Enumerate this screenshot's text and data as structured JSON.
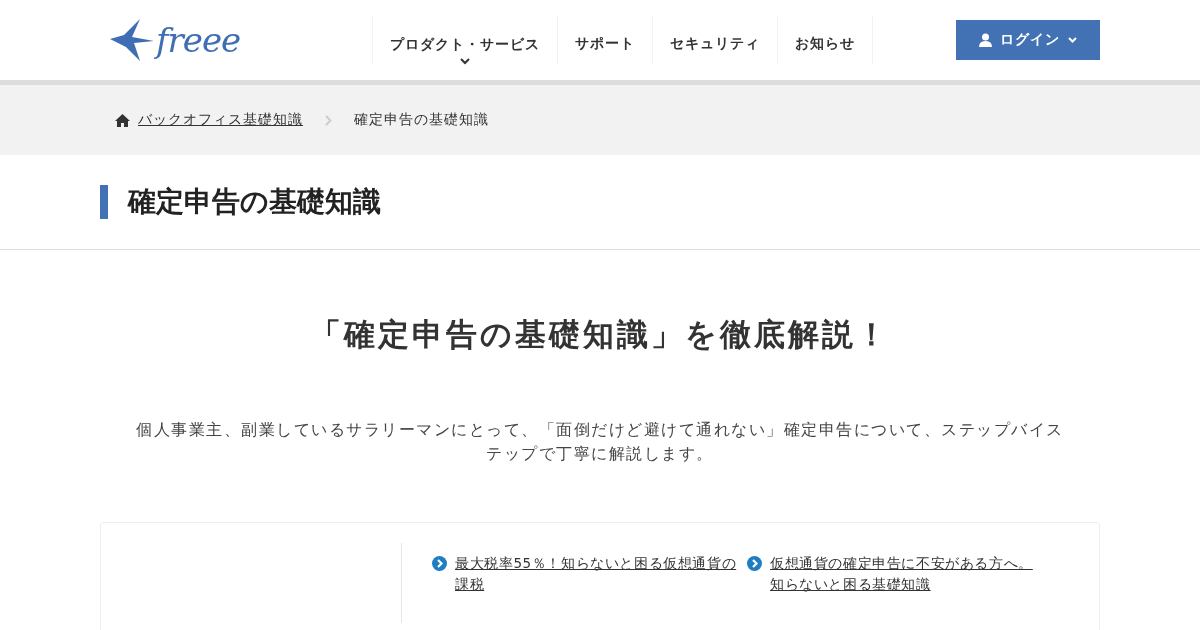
{
  "header": {
    "logo": "freee",
    "nav": [
      {
        "label": "プロダクト・サービス",
        "has_dropdown": true
      },
      {
        "label": "サポート",
        "has_dropdown": false
      },
      {
        "label": "セキュリティ",
        "has_dropdown": false
      },
      {
        "label": "お知らせ",
        "has_dropdown": false
      }
    ],
    "login_button": "ログイン"
  },
  "breadcrumb": [
    {
      "label": "バックオフィス基礎知識",
      "link": true
    },
    {
      "label": "確定申告の基礎知識",
      "link": false
    }
  ],
  "page_title": "確定申告の基礎知識",
  "headline": "「確定申告の基礎知識」を徹底解説！",
  "lead": "個人事業主、副業しているサラリーマンにとって、「面倒だけど避けて通れない」確定申告について、ステップバイステップで丁寧に解説します。",
  "articles": [
    {
      "title": "最大税率55％！知らないと困る仮想通貨の課税"
    },
    {
      "title": "仮想通貨の確定申告に不安がある方へ。知らないと困る基礎知識"
    }
  ]
}
